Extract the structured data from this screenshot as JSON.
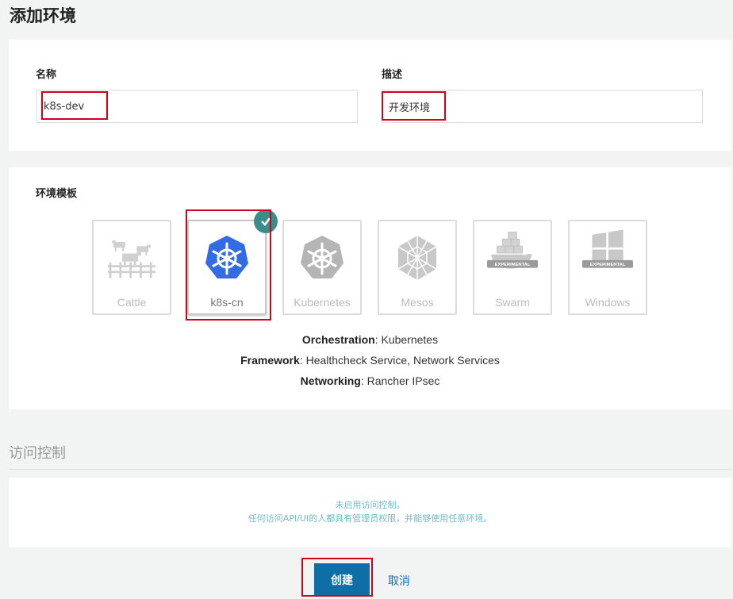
{
  "page": {
    "title": "添加环境"
  },
  "form": {
    "name_label": "名称",
    "name_value": "k8s-dev",
    "desc_label": "描述",
    "desc_value": "开发环境"
  },
  "templates": {
    "section_label": "环境模板",
    "items": [
      {
        "name": "Cattle",
        "icon": "cattle-icon",
        "selected": false
      },
      {
        "name": "k8s-cn",
        "icon": "kubernetes-wheel-icon",
        "selected": true
      },
      {
        "name": "Kubernetes",
        "icon": "kubernetes-wheel-icon",
        "selected": false
      },
      {
        "name": "Mesos",
        "icon": "mesos-icon",
        "selected": false
      },
      {
        "name": "Swarm",
        "icon": "docker-whale-icon",
        "selected": false,
        "badge": "EXPERIMENTAL"
      },
      {
        "name": "Windows",
        "icon": "windows-icon",
        "selected": false,
        "badge": "EXPERIMENTAL"
      }
    ],
    "details": [
      {
        "key": "Orchestration",
        "value": "Kubernetes"
      },
      {
        "key": "Framework",
        "value": "Healthcheck Service, Network Services"
      },
      {
        "key": "Networking",
        "value": "Rancher IPsec"
      }
    ]
  },
  "access": {
    "heading": "访问控制",
    "line1": "未启用访问控制。",
    "line2": "任何访问API/UI的人都具有管理员权限，并能够使用任意环境。"
  },
  "actions": {
    "create_label": "创建",
    "cancel_label": "取消"
  },
  "colors": {
    "accent": "#0d6fa6",
    "highlight": "#d0021b",
    "k8s_blue": "#326ce5",
    "check": "#3b8c8c"
  }
}
